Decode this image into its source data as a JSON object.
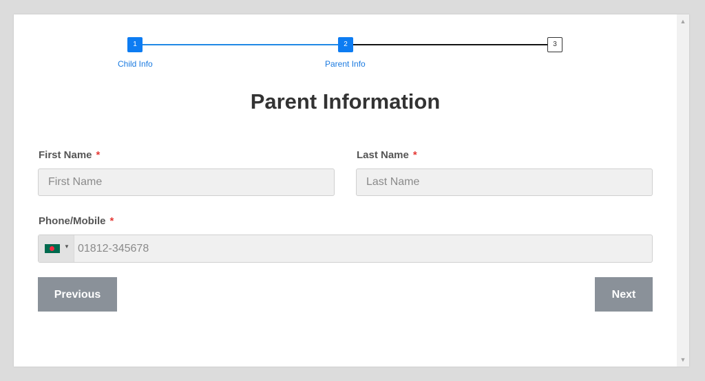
{
  "stepper": {
    "steps": [
      {
        "number": "1",
        "label": "Child Info",
        "state": "done"
      },
      {
        "number": "2",
        "label": "Parent Info",
        "state": "active"
      },
      {
        "number": "3",
        "label": "",
        "state": "pending"
      }
    ],
    "active_color": "#0d7cf2"
  },
  "form": {
    "title": "Parent Information",
    "required_mark": "*",
    "first_name": {
      "label": "First Name",
      "placeholder": "First Name"
    },
    "last_name": {
      "label": "Last Name",
      "placeholder": "Last Name"
    },
    "phone": {
      "label": "Phone/Mobile",
      "placeholder": "01812-345678",
      "country_flag": "bangladesh-flag-icon"
    }
  },
  "buttons": {
    "previous": "Previous",
    "next": "Next"
  }
}
